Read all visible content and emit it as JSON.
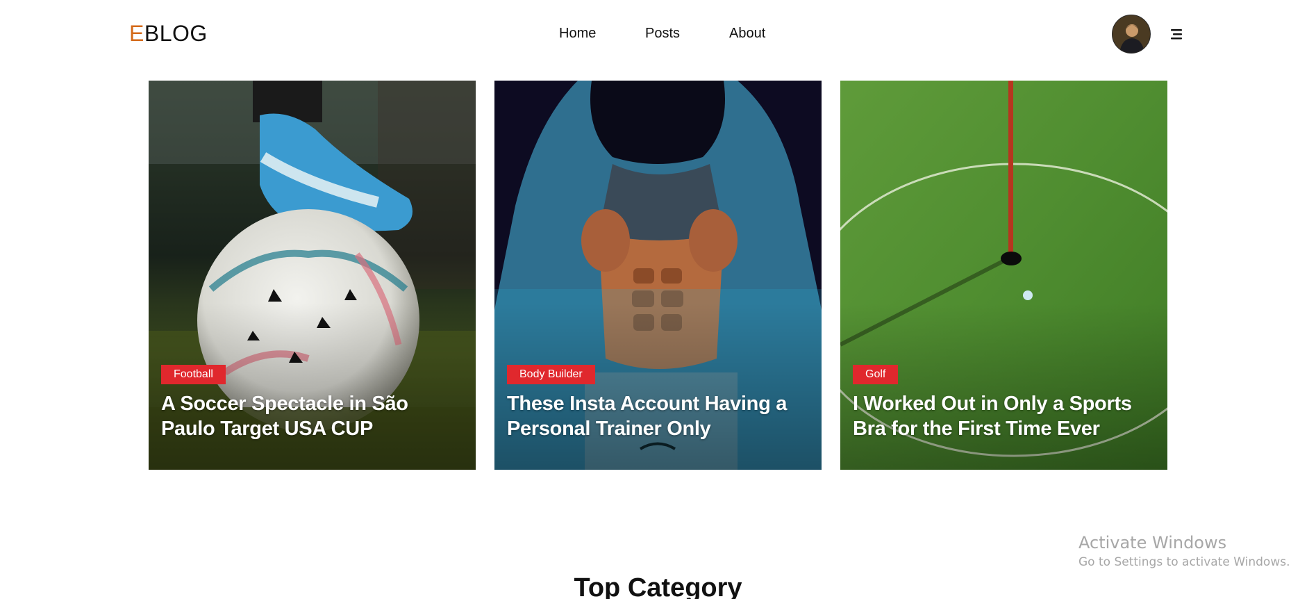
{
  "brand": {
    "logo_accent": "E",
    "logo_rest": "BLOG",
    "accent_color": "#d46a1a"
  },
  "nav": {
    "items": [
      "Home",
      "Posts",
      "About"
    ]
  },
  "header": {
    "avatar_icon": "user-avatar",
    "menu_icon": "hamburger-menu-icon"
  },
  "cards": [
    {
      "category": "Football",
      "title": "A Soccer Spectacle in São Paulo Target USA CUP"
    },
    {
      "category": "Body Builder",
      "title": "These Insta Account Having a Personal Trainer Only"
    },
    {
      "category": "Golf",
      "title": "I Worked Out in Only a Sports Bra for the First Time Ever"
    }
  ],
  "section": {
    "title": "Top Category"
  },
  "watermark": {
    "line1": "Activate Windows",
    "line2": "Go to Settings to activate Windows."
  },
  "colors": {
    "badge": "#e0282d"
  }
}
